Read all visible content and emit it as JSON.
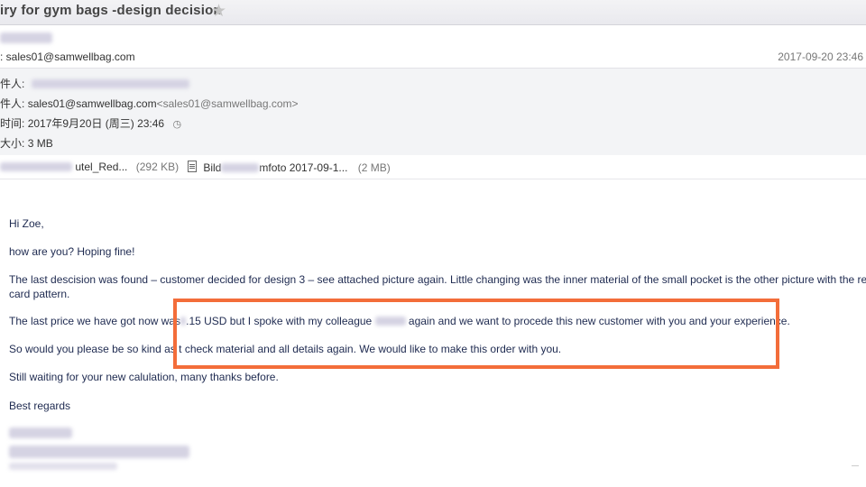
{
  "header": {
    "subject": "iry for gym bags -design decision"
  },
  "sender": {
    "from_prefix": ": sales01@samwellbag.com",
    "date": "2017-09-20 23:46"
  },
  "meta": {
    "to_label": "件人:",
    "from_label": "件人:",
    "from_value": "sales01@samwellbag.com",
    "from_email": "<sales01@samwellbag.com>",
    "time_label": "时间:",
    "time_value": "2017年9月20日 (周三) 23:46",
    "size_label": "大小:",
    "size_value": "3 MB"
  },
  "attachments": [
    {
      "name": "utel_Red...",
      "size": "(292 KB)"
    },
    {
      "name": "Bild",
      "name_suffix": "mfoto 2017-09-1...",
      "size": "(2 MB)"
    }
  ],
  "body": {
    "greeting": "Hi Zoe,",
    "line1": "how are you? Hoping fine!",
    "line2": "The last descision was found – customer decided for design 3 – see attached picture again. Little changing was the inner material of the small pocket is the other picture with the red card pattern.",
    "line3_a": "The last price we have got now was",
    "line3_b": ".15 USD but I spoke with my colleague",
    "line3_c": "again and we want to procede this new customer with you and your experience.",
    "line4_a": "So would you please be so kind as t",
    "line4_b": "check material and all details again. We would like to make this order with you.",
    "line5": "Still waiting for your new calulation, many thanks before.",
    "closing": "Best regards"
  },
  "colors": {
    "highlight": "#f36d3a",
    "body_text": "#1e2a50"
  }
}
